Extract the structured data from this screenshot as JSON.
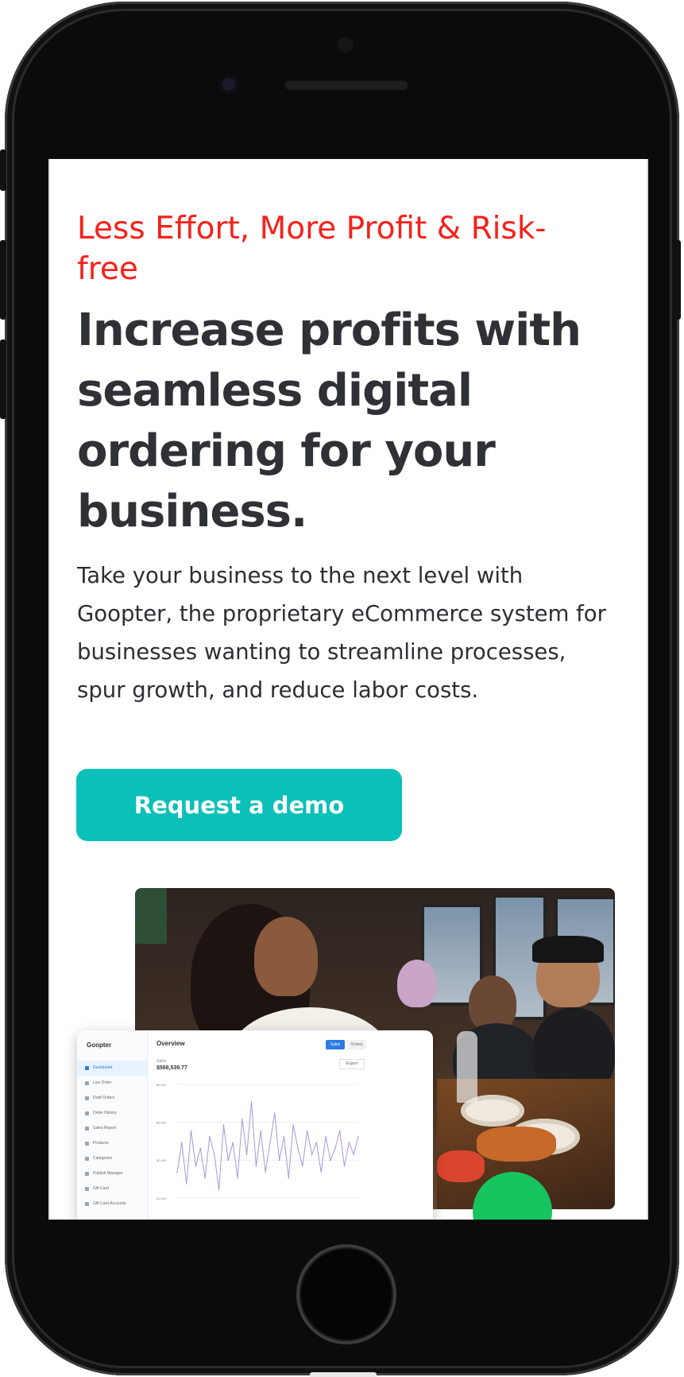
{
  "page": {
    "tagline": "Less Effort, More Profit & Risk-free",
    "headline": "Increase profits with seamless digital ordering for your business.",
    "lead": "Take your business to the next level with Goopter, the proprietary eCommerce system for businesses wanting to streamline processes, spur growth, and reduce labor costs.",
    "cta_label": "Request a demo"
  },
  "dashboard": {
    "brand": "Goopter",
    "title": "Overview",
    "tabs": [
      "Sales",
      "Orders"
    ],
    "export_label": "Export",
    "sales_label": "Sales",
    "sales_value": "$568,539.77",
    "nav": [
      "Dashboard",
      "Live Order",
      "Draft Orders",
      "Order History",
      "Sales Report",
      "Products",
      "Categories",
      "Publish Manager",
      "Gift Card",
      "Gift Card Accounts"
    ],
    "chart_data": {
      "type": "line",
      "yticks": [
        "$6,000",
        "$4,000",
        "$2,000",
        "$1,000"
      ],
      "values": [
        0.35,
        0.6,
        0.25,
        0.7,
        0.4,
        0.55,
        0.3,
        0.65,
        0.5,
        0.2,
        0.75,
        0.45,
        0.6,
        0.3,
        0.8,
        0.5,
        0.95,
        0.4,
        0.7,
        0.35,
        0.6,
        0.85,
        0.45,
        0.65,
        0.3,
        0.75,
        0.55,
        0.4,
        0.7,
        0.5,
        0.6,
        0.35,
        0.65,
        0.45,
        0.55,
        0.7,
        0.4,
        0.6,
        0.5,
        0.65
      ]
    }
  },
  "colors": {
    "tagline": "#f5221b",
    "headline": "#2f3137",
    "cta": "#0ac0b8",
    "chart_line": "#a995d8",
    "fab": "#17c45e"
  }
}
